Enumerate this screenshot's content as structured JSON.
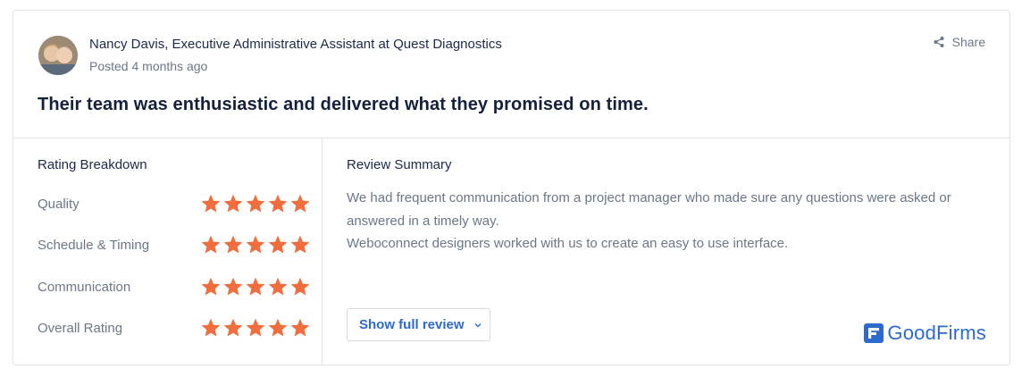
{
  "reviewer": {
    "name": "Nancy Davis, Executive Administrative Assistant at Quest Diagnostics",
    "posted": "Posted 4 months ago"
  },
  "share": {
    "label": "Share",
    "icon": "share-icon"
  },
  "headline": "Their team was enthusiastic and delivered what they promised on time.",
  "rating_breakdown": {
    "title": "Rating Breakdown",
    "max_stars": 5,
    "star_color": "#f26d3d",
    "items": [
      {
        "label": "Quality",
        "stars": 5
      },
      {
        "label": "Schedule & Timing",
        "stars": 5
      },
      {
        "label": "Communication",
        "stars": 5
      },
      {
        "label": "Overall Rating",
        "stars": 5
      }
    ]
  },
  "review_summary": {
    "title": "Review Summary",
    "paragraphs": [
      "We had frequent communication from a project manager who made sure any questions were asked or answered in a timely way.",
      "Weboconnect designers worked with us to create an easy to use interface."
    ]
  },
  "show_full_review": {
    "label": "Show full review",
    "icon": "chevron-down-icon"
  },
  "brand": {
    "name": "GoodFirms",
    "color": "#2c6bcd",
    "icon": "goodfirms-logo-icon"
  }
}
